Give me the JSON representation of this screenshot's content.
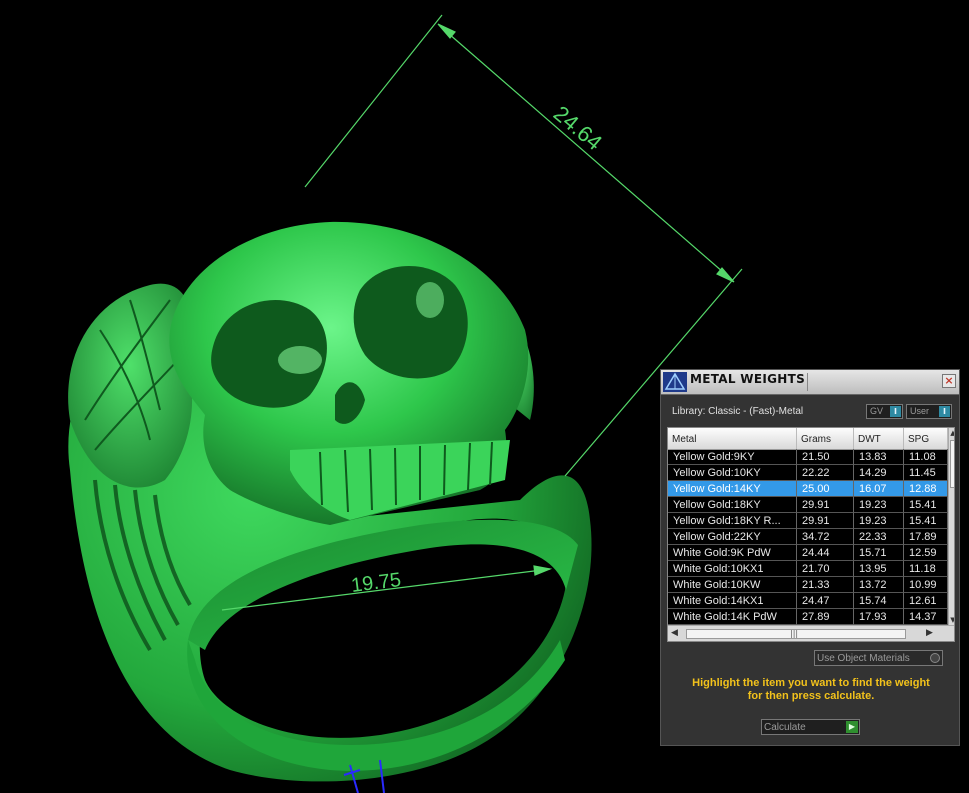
{
  "viewport": {
    "dimension_top": "24.64",
    "dimension_inner": "19.75",
    "model_color": "#2fbf4a",
    "dimension_color": "#55d86a"
  },
  "panel": {
    "title": "METAL WEIGHTS",
    "close_label": "×",
    "logo_icon": "gem-logo-icon",
    "library_label": "Library: Classic - (Fast)-Metal",
    "gv_label": "GV",
    "user_label": "User",
    "table": {
      "headers": [
        "Metal",
        "Grams",
        "DWT",
        "SPG"
      ],
      "rows": [
        [
          "Yellow Gold:9KY",
          "21.50",
          "13.83",
          "11.08"
        ],
        [
          "Yellow Gold:10KY",
          "22.22",
          "14.29",
          "11.45"
        ],
        [
          "Yellow Gold:14KY",
          "25.00",
          "16.07",
          "12.88"
        ],
        [
          "Yellow Gold:18KY",
          "29.91",
          "19.23",
          "15.41"
        ],
        [
          "Yellow Gold:18KY R...",
          "29.91",
          "19.23",
          "15.41"
        ],
        [
          "Yellow Gold:22KY",
          "34.72",
          "22.33",
          "17.89"
        ],
        [
          "White Gold:9K PdW",
          "24.44",
          "15.71",
          "12.59"
        ],
        [
          "White Gold:10KX1",
          "21.70",
          "13.95",
          "11.18"
        ],
        [
          "White Gold:10KW",
          "21.33",
          "13.72",
          "10.99"
        ],
        [
          "White Gold:14KX1",
          "24.47",
          "15.74",
          "12.61"
        ],
        [
          "White Gold:14K PdW",
          "27.89",
          "17.93",
          "14.37"
        ]
      ],
      "selected_row": 2,
      "selected_color": "#3399e8"
    },
    "use_object_materials": "Use Object Materials",
    "hint_line1": "Highlight the item you want to find the weight",
    "hint_line2": "for then press calculate.",
    "hint_color": "#f2c21b",
    "calculate_label": "Calculate"
  }
}
